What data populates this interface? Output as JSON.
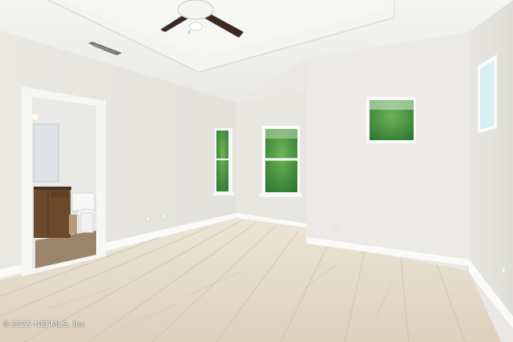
{
  "photo": {
    "watermark": "©2025 NEFMLS, Inc",
    "colors": {
      "wall": "#eceae5",
      "wall_shade": "#e2e0da",
      "ceiling": "#f1f1ef",
      "floor_light": "#e6dccb",
      "floor_dark": "#d6c9b3",
      "baseboard": "#ffffff",
      "foliage": "#3f8f3a",
      "vanity": "#6b4a2b"
    }
  }
}
